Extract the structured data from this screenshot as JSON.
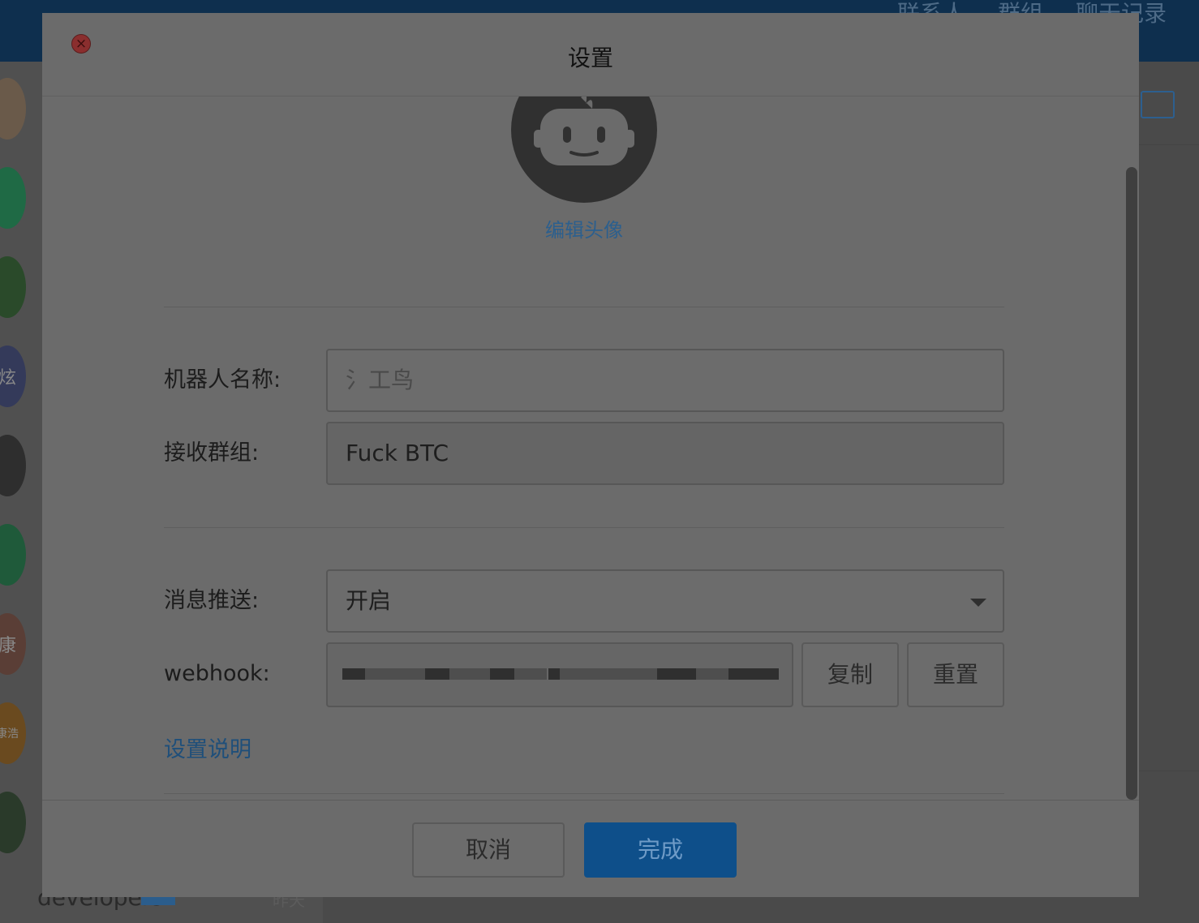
{
  "background": {
    "top_nav": [
      "联系人",
      "群组",
      "聊天记录"
    ],
    "sidebar_avatars": [
      "",
      "",
      "",
      "炫",
      "",
      "",
      "康",
      "康浩",
      ""
    ],
    "developers_label": "developers",
    "time_label": "昨天"
  },
  "dialog": {
    "title": "设置",
    "close_icon": "close-icon",
    "edit_avatar_label": "编辑头像",
    "robot_name": {
      "label": "机器人名称:",
      "placeholder": "氵工鸟"
    },
    "receive_group": {
      "label": "接收群组:",
      "value": "Fuck BTC"
    },
    "message_push": {
      "label": "消息推送:",
      "selected": "开启"
    },
    "webhook": {
      "label": "webhook:",
      "value": "",
      "copy_label": "复制",
      "reset_label": "重置"
    },
    "help_link": "设置说明",
    "cancel_label": "取消",
    "done_label": "完成"
  },
  "colors": {
    "primary": "#0e4f8a",
    "link": "#2b5f8e",
    "close": "#8a2e2e"
  }
}
